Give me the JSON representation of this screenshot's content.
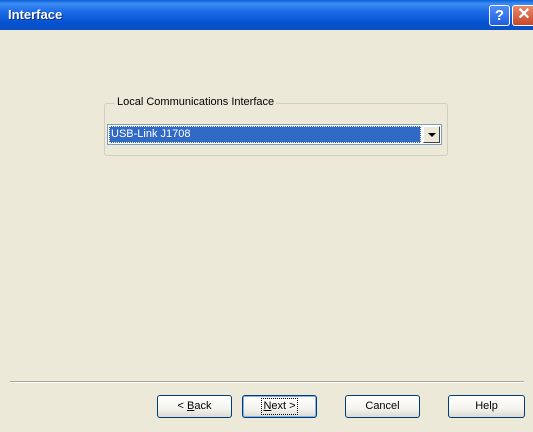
{
  "window": {
    "title": "Interface"
  },
  "titlebar_buttons": {
    "help_glyph": "?",
    "close_glyph": "✕",
    "help_icon": "help-icon",
    "close_icon": "close-icon"
  },
  "group": {
    "label": "Local Communications Interface"
  },
  "combo": {
    "selected": "USB-Link J1708",
    "arrow_icon": "chevron-down-icon"
  },
  "buttons": {
    "back_prefix": "< ",
    "back_mnemonic": "B",
    "back_rest": "ack",
    "next_mnemonic": "N",
    "next_rest": "ext >",
    "cancel": "Cancel",
    "help": "Help"
  },
  "colors": {
    "titlebar": "#0553d0",
    "dialog_bg": "#ece9d8",
    "selection": "#316ac5"
  }
}
